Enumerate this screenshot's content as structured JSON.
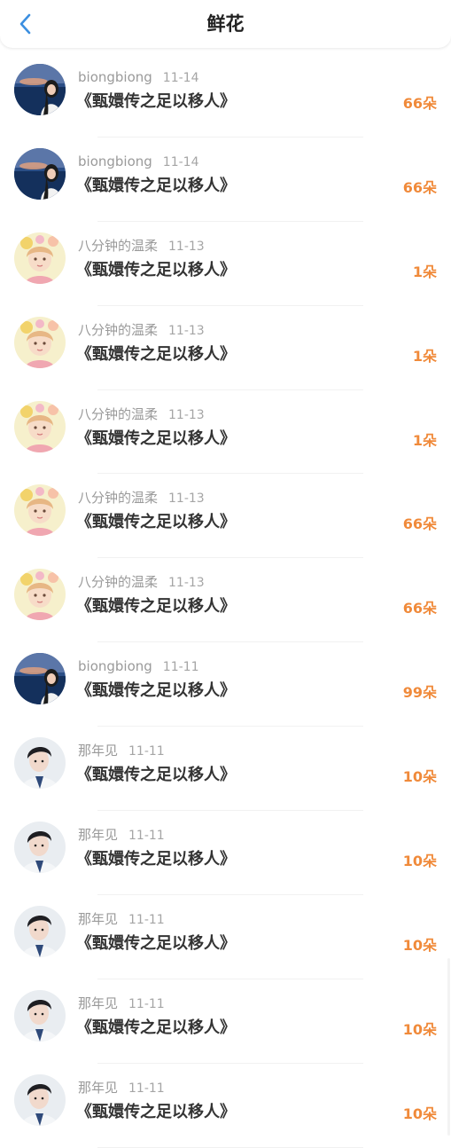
{
  "header": {
    "title": "鲜花",
    "back_icon": "chevron-left-icon",
    "accent_color": "#3b8fe0"
  },
  "colors": {
    "count": "#f08a3a",
    "meta": "#9a9a9a",
    "title": "#333333"
  },
  "items": [
    {
      "user": "biongbiong",
      "date": "11-14",
      "title": "《甄嬛传之足以移人》",
      "count": "66朵",
      "avatar": "sea"
    },
    {
      "user": "biongbiong",
      "date": "11-14",
      "title": "《甄嬛传之足以移人》",
      "count": "66朵",
      "avatar": "sea"
    },
    {
      "user": "八分钟的温柔",
      "date": "11-13",
      "title": "《甄嬛传之足以移人》",
      "count": "1朵",
      "avatar": "flower"
    },
    {
      "user": "八分钟的温柔",
      "date": "11-13",
      "title": "《甄嬛传之足以移人》",
      "count": "1朵",
      "avatar": "flower"
    },
    {
      "user": "八分钟的温柔",
      "date": "11-13",
      "title": "《甄嬛传之足以移人》",
      "count": "1朵",
      "avatar": "flower"
    },
    {
      "user": "八分钟的温柔",
      "date": "11-13",
      "title": "《甄嬛传之足以移人》",
      "count": "66朵",
      "avatar": "flower"
    },
    {
      "user": "八分钟的温柔",
      "date": "11-13",
      "title": "《甄嬛传之足以移人》",
      "count": "66朵",
      "avatar": "flower"
    },
    {
      "user": "biongbiong",
      "date": "11-11",
      "title": "《甄嬛传之足以移人》",
      "count": "99朵",
      "avatar": "sea"
    },
    {
      "user": "那年见",
      "date": "11-11",
      "title": "《甄嬛传之足以移人》",
      "count": "10朵",
      "avatar": "man"
    },
    {
      "user": "那年见",
      "date": "11-11",
      "title": "《甄嬛传之足以移人》",
      "count": "10朵",
      "avatar": "man"
    },
    {
      "user": "那年见",
      "date": "11-11",
      "title": "《甄嬛传之足以移人》",
      "count": "10朵",
      "avatar": "man"
    },
    {
      "user": "那年见",
      "date": "11-11",
      "title": "《甄嬛传之足以移人》",
      "count": "10朵",
      "avatar": "man"
    },
    {
      "user": "那年见",
      "date": "11-11",
      "title": "《甄嬛传之足以移人》",
      "count": "10朵",
      "avatar": "man"
    }
  ]
}
